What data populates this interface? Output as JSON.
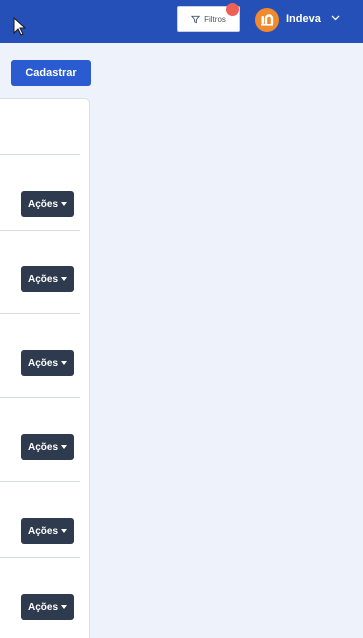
{
  "header": {
    "filter_label": "Filtros",
    "user_name": "Indeva"
  },
  "toolbar": {
    "cadastrar_label": "Cadastrar"
  },
  "table": {
    "rows": [
      {
        "actions_label": "Ações"
      },
      {
        "actions_label": "Ações"
      },
      {
        "actions_label": "Ações"
      },
      {
        "actions_label": "Ações"
      },
      {
        "actions_label": "Ações"
      },
      {
        "actions_label": "Ações"
      }
    ]
  },
  "colors": {
    "topbar": "#2550b8",
    "primary_button": "#2a5bd0",
    "actions_button": "#2e3b4e",
    "badge": "#ee5f55",
    "avatar": "#f08a2c",
    "background": "#eef2fb"
  },
  "icons": {
    "filter": "filter-icon",
    "avatar": "indeva-logo-icon",
    "user_menu": "chevron-down-icon",
    "actions_caret": "caret-down-icon"
  }
}
